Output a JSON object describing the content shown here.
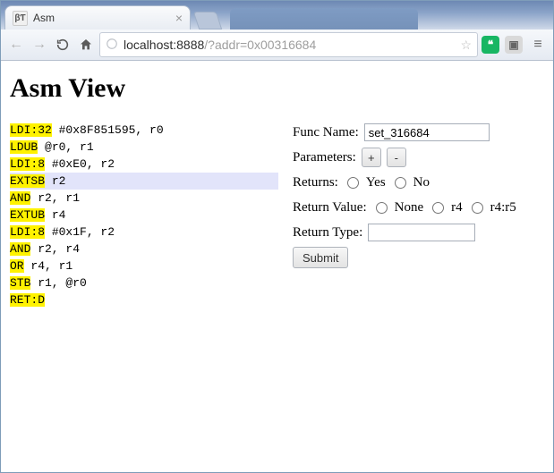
{
  "browser": {
    "tab_title": "Asm",
    "url_host": "localhost:8888",
    "url_rest": "/?addr=0x00316684"
  },
  "page": {
    "title": "Asm View"
  },
  "asm": [
    {
      "mnem": "LDI:32",
      "rest": " #0x8F851595, r0",
      "hl": false
    },
    {
      "mnem": "LDUB",
      "rest": " @r0, r1",
      "hl": false
    },
    {
      "mnem": "LDI:8",
      "rest": " #0xE0, r2",
      "hl": false
    },
    {
      "mnem": "EXTSB",
      "rest": " r2",
      "hl": true
    },
    {
      "mnem": "AND",
      "rest": " r2, r1",
      "hl": false
    },
    {
      "mnem": "EXTUB",
      "rest": " r4",
      "hl": false
    },
    {
      "mnem": "LDI:8",
      "rest": " #0x1F, r2",
      "hl": false
    },
    {
      "mnem": "AND",
      "rest": " r2, r4",
      "hl": false
    },
    {
      "mnem": "OR",
      "rest": " r4, r1",
      "hl": false
    },
    {
      "mnem": "STB",
      "rest": " r1, @r0",
      "hl": false
    },
    {
      "mnem": "RET:D",
      "rest": "",
      "hl": false
    }
  ],
  "form": {
    "func_name_label": "Func Name:",
    "func_name_value": "set_316684",
    "parameters_label": "Parameters:",
    "plus_label": "+",
    "minus_label": "-",
    "returns_label": "Returns:",
    "returns_options": [
      "Yes",
      "No"
    ],
    "return_value_label": "Return Value:",
    "return_value_options": [
      "None",
      "r4",
      "r4:r5"
    ],
    "return_type_label": "Return Type:",
    "return_type_value": "",
    "submit_label": "Submit"
  }
}
